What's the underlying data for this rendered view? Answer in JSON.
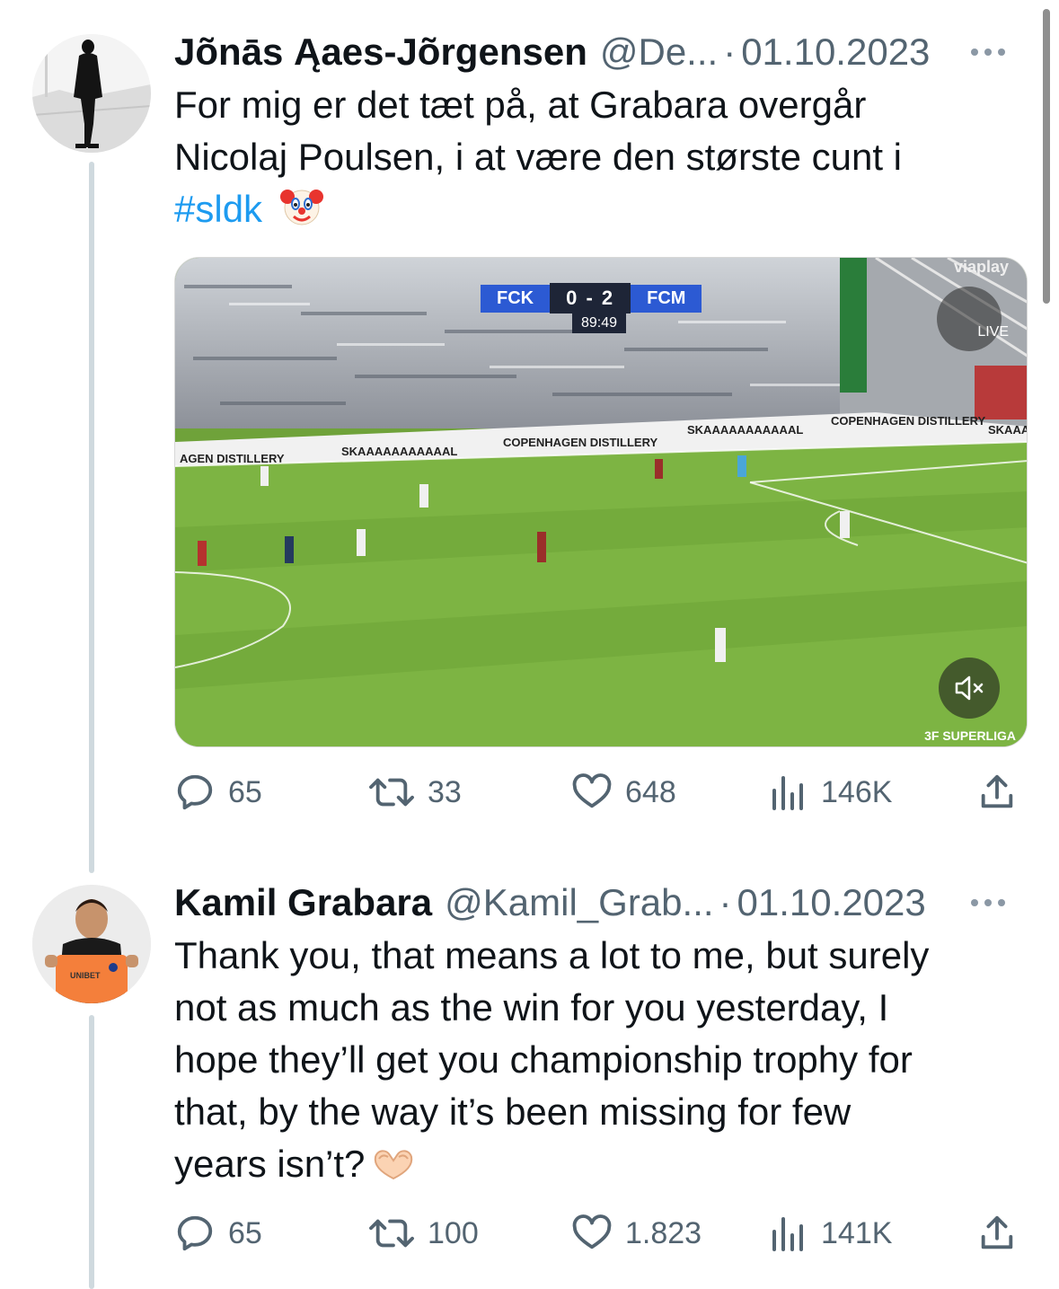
{
  "tweets": [
    {
      "author_name": "Jõnās Ąaes-Jõrgensen",
      "handle": "@De...",
      "separator": "·",
      "date": "01.10.2023",
      "text_lines": [
        "For mig er det tæt på, at Grabara overgår",
        "Nicolaj Poulsen, i at være den største cunt i"
      ],
      "hashtag": "#sldk",
      "emoji_icon": "clown-face-icon",
      "media": {
        "home_team": "FCK",
        "score": "0 - 2",
        "away_team": "FCM",
        "clock": "89:49",
        "channel_logo": "viaplay",
        "live_label": "LIVE",
        "broadcaster_logo": "3F SUPERLIGA",
        "board_text_1": "SKAAAAAAAAAAAL",
        "board_text_2": "COPENHAGEN DISTILLERY",
        "board_text_3": "AGEN DISTILLERY",
        "board_text_4": "COPENHAGEN DISTILLERY",
        "board_text_5": "SKAAAAAAAAAAAL",
        "board_text_6": "SKAAAA",
        "muted": true
      },
      "replies": "65",
      "retweets": "33",
      "likes": "648",
      "views": "146K"
    },
    {
      "author_name": "Kamil Grabara",
      "handle": "@Kamil_Grab...",
      "separator": "·",
      "date": "01.10.2023",
      "text_lines": [
        "Thank you, that means a lot to me, but surely",
        "not as much as the win for you yesterday, I",
        "hope they’ll get you championship trophy for",
        "that, by the way it’s been missing for few",
        "years isn’t?"
      ],
      "emoji_icon": "heart-hands-icon",
      "replies": "65",
      "retweets": "100",
      "likes": "1.823",
      "views": "141K"
    }
  ],
  "colors": {
    "text": "#0f1419",
    "secondary": "#536471",
    "link": "#1d9bf0",
    "thread_line": "#cfd9de",
    "pitch": "#7db443"
  }
}
